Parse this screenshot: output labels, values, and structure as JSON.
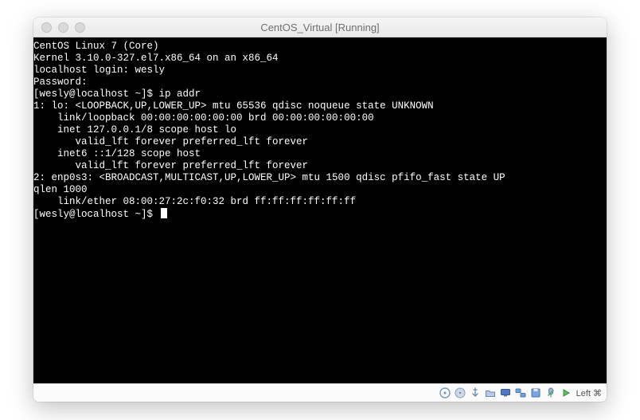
{
  "window": {
    "title": "CentOS_Virtual [Running]"
  },
  "terminal": {
    "lines": [
      "CentOS Linux 7 (Core)",
      "Kernel 3.10.0-327.el7.x86_64 on an x86_64",
      "",
      "localhost login: wesly",
      "Password:",
      "[wesly@localhost ~]$ ip addr",
      "1: lo: <LOOPBACK,UP,LOWER_UP> mtu 65536 qdisc noqueue state UNKNOWN",
      "    link/loopback 00:00:00:00:00:00 brd 00:00:00:00:00:00",
      "    inet 127.0.0.1/8 scope host lo",
      "       valid_lft forever preferred_lft forever",
      "    inet6 ::1/128 scope host",
      "       valid_lft forever preferred_lft forever",
      "2: enp0s3: <BROADCAST,MULTICAST,UP,LOWER_UP> mtu 1500 qdisc pfifo_fast state UP",
      "qlen 1000",
      "    link/ether 08:00:27:2c:f0:32 brd ff:ff:ff:ff:ff:ff",
      "[wesly@localhost ~]$ "
    ]
  },
  "statusbar": {
    "host_key_label": "Left ⌘",
    "icons": [
      "disc-icon",
      "hard-disk-icon",
      "usb-icon",
      "shared-folder-icon",
      "display-icon",
      "network-icon",
      "floppy-icon",
      "mouse-capture-icon",
      "recording-icon"
    ]
  }
}
